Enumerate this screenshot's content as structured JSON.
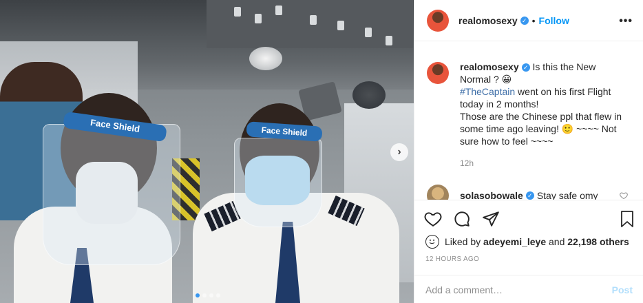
{
  "post": {
    "author": "realomosexy",
    "follow_label": "Follow",
    "separator": "•",
    "more_label": "•••",
    "caption_line1": " Is this the New Normal ? 😀",
    "hashtag": "#TheCaptain",
    "caption_line2": " went on his first Flight today in 2 months!",
    "caption_line3": "Those are the Chinese ppl that flew in some time ago leaving! 🙂 ~~~~ Not sure how to feel ~~~~",
    "time_ago": "12h",
    "face_shield_text": "Face Shield"
  },
  "comments": [
    {
      "username": "solasobowale",
      "text": "Stay safe omy"
    }
  ],
  "likes": {
    "prefix": "Liked by ",
    "first_liker": "adeyemi_leye",
    "middle": " and ",
    "count_text": "22,198 others"
  },
  "date_label": "12 HOURS AGO",
  "add_comment": {
    "placeholder": "Add a comment…",
    "post_label": "Post"
  },
  "carousel": {
    "next_label": "›",
    "total": 4,
    "active_index": 0
  },
  "colors": {
    "accent": "#0095f6",
    "verified": "#3897f0",
    "post_disabled": "#b2dffc"
  }
}
